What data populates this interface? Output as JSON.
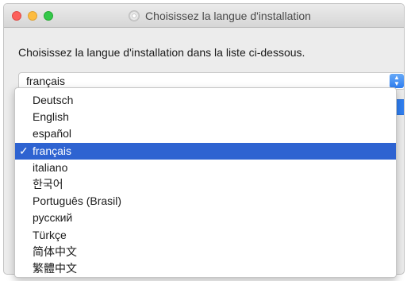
{
  "window": {
    "title": "Choisissez la langue d'installation"
  },
  "prompt": "Choisissez la langue d'installation dans la liste ci-dessous.",
  "select": {
    "value": "français"
  },
  "languages": [
    "Deutsch",
    "English",
    "español",
    "français",
    "italiano",
    "한국어",
    "Português (Brasil)",
    "русский",
    "Türkçe",
    "简体中文",
    "繁體中文"
  ],
  "selected_index": 3,
  "icons": {
    "checkmark": "✓",
    "disc": "disc-icon"
  },
  "colors": {
    "selection": "#2e63d1",
    "accent": "#2f7ef0"
  }
}
